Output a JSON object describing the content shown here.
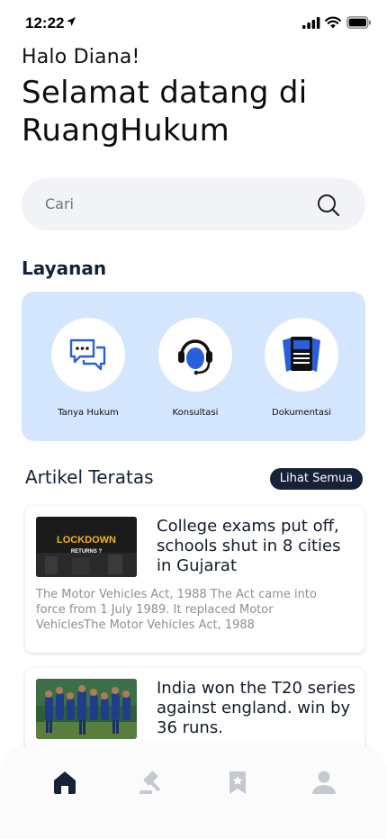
{
  "status_bar": {
    "time": "12:22"
  },
  "header": {
    "greeting": "Halo Diana!",
    "welcome_line1": "Selamat datang di",
    "welcome_line2": "RuangHukum"
  },
  "search": {
    "placeholder": "Cari"
  },
  "services": {
    "title": "Layanan",
    "items": [
      {
        "label": "Tanya Hukum",
        "icon": "chat-icon"
      },
      {
        "label": "Konsultasi",
        "icon": "headset-icon"
      },
      {
        "label": "Dokumentasi",
        "icon": "document-icon"
      }
    ]
  },
  "articles": {
    "title": "Artikel Teratas",
    "see_all": "Lihat Semua",
    "items": [
      {
        "title": "College exams put off, schools shut in 8 cities in Gujarat",
        "thumb_text_1": "LOCKDOWN",
        "thumb_text_2": "RETURNS ?",
        "description": "The Motor Vehicles Act, 1988 The Act came into force from 1 July 1989. It replaced Motor VehiclesThe Motor Vehicles Act, 1988"
      },
      {
        "title": "India won the T20 series against england. win by 36 runs."
      }
    ]
  },
  "bottom_nav": {
    "items": [
      "home-icon",
      "gavel-icon",
      "bookmark-icon",
      "profile-icon"
    ],
    "active": "home-icon"
  },
  "colors": {
    "accent_dark": "#152238",
    "services_bg": "#d3e6fd",
    "icon_blue": "#2b5fd9"
  }
}
